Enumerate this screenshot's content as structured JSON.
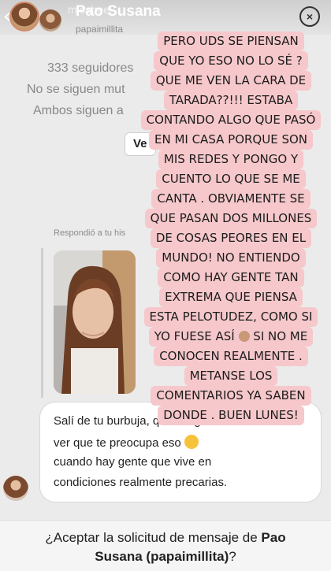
{
  "story": {
    "username_faded": "micabeel",
    "title": "Pao Susana",
    "close_icon": "×"
  },
  "profile": {
    "handle": "papaimillita",
    "followers": "333 seguidores",
    "not_following": "No se siguen mut",
    "both_follow": "Ambos siguen a",
    "view_button": "Ve"
  },
  "message": {
    "replied_to": "Respondió a tu his",
    "lines": [
      "Salí de tu burbuja, qué indignante",
      "ver que te preocupa eso",
      "cuando hay gente que vive en",
      "condiciones realmente precarias."
    ]
  },
  "request": {
    "question_prefix": "¿Aceptar la solicitud de mensaje de",
    "name_part1": "Pao",
    "name_part2": "Susana (papaimillita)",
    "question_suffix": "?"
  },
  "overlay": {
    "lines": [
      "PERO UDS SE PIENSAN",
      "QUE YO ESO NO LO SÉ ?",
      "QUE ME VEN LA CARA DE",
      "TARADA??!!! ESTABA",
      "CONTANDO ALGO QUE PASÓ",
      "EN MI CASA PORQUE SON",
      "MIS REDES Y PONGO Y",
      "CUENTO LO QUE SE ME",
      "CANTA . OBVIAMENTE SE",
      "QUE PASAN DOS MILLONES",
      "DE COSAS PEORES EN EL",
      "MUNDO! NO ENTIENDO",
      "COMO HAY GENTE TAN",
      "EXTREMA QUE PIENSA",
      "ESTA PELOTUDEZ, COMO SI",
      "YO FUESE ASÍ",
      "SI NO ME",
      "CONOCEN REALMENTE .",
      "METANSE LOS",
      "COMENTARIOS YA SABEN",
      "DONDE . BUEN LUNES!"
    ]
  },
  "colors": {
    "overlay_highlight": "#f6c8cb",
    "background": "#ebebeb"
  }
}
